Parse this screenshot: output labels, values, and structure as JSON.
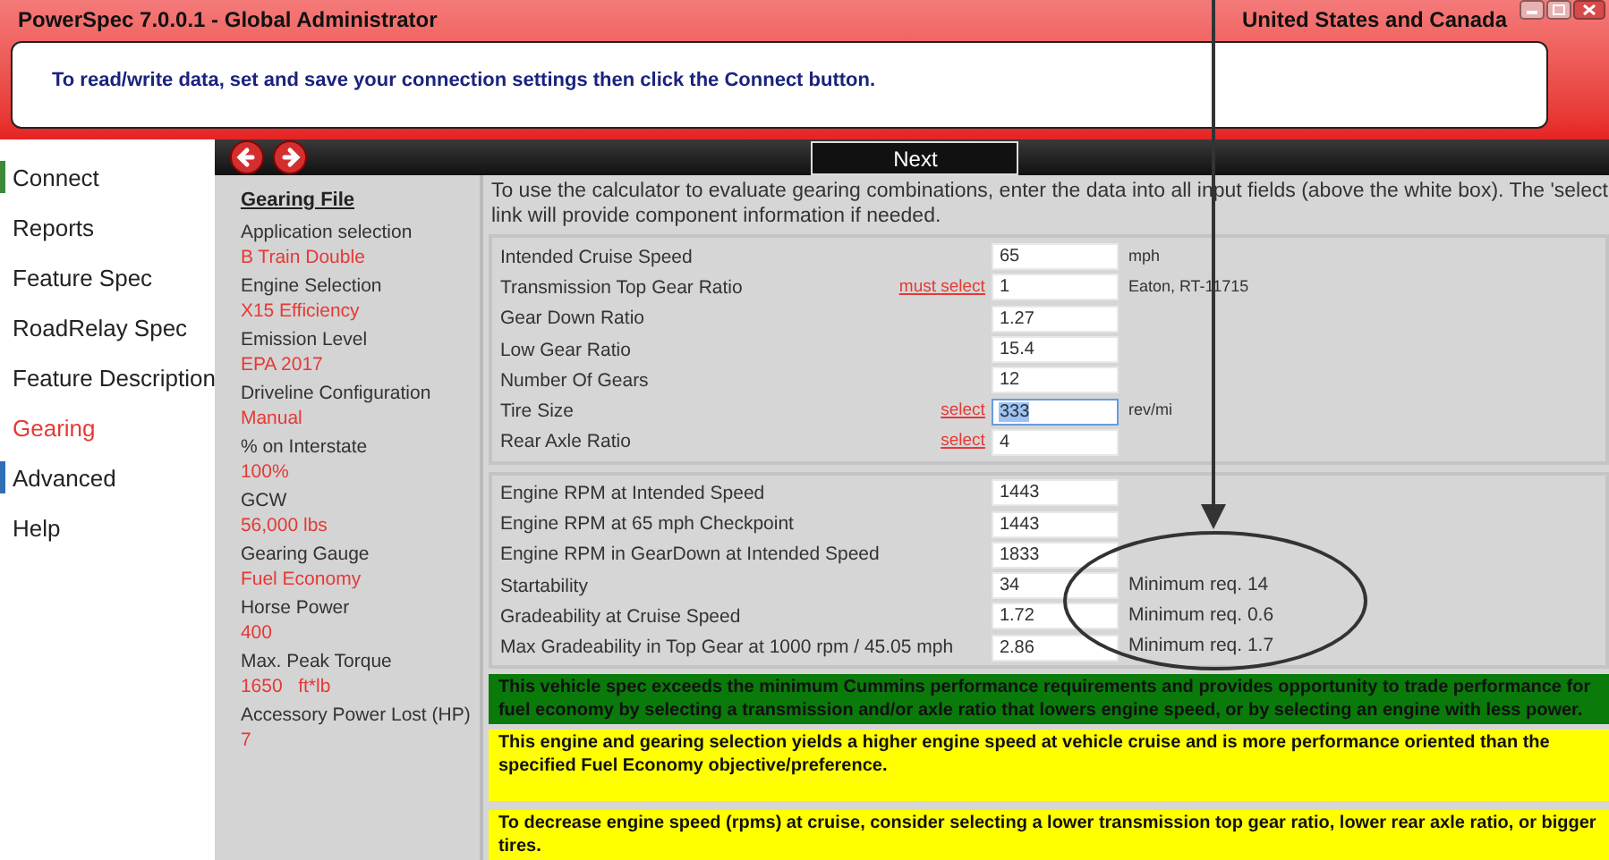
{
  "window": {
    "title": "PowerSpec 7.0.0.1 - Global Administrator",
    "region": "United States and Canada"
  },
  "message": "To read/write data, set and save your connection settings then click the Connect button.",
  "nav": [
    {
      "label": "Connect",
      "selected": false,
      "color": "#3a8a3a"
    },
    {
      "label": "Reports",
      "selected": false
    },
    {
      "label": "Feature Spec",
      "selected": false
    },
    {
      "label": "RoadRelay Spec",
      "selected": false
    },
    {
      "label": "Feature Description",
      "selected": false
    },
    {
      "label": "Gearing",
      "selected": true
    },
    {
      "label": "Advanced",
      "selected": false,
      "color": "#2f6fb5"
    },
    {
      "label": "Help",
      "selected": false
    }
  ],
  "toolbar": {
    "next": "Next"
  },
  "summary": {
    "title": "Gearing File",
    "items": [
      {
        "label": "Application selection",
        "value": "B Train Double"
      },
      {
        "label": "Engine Selection",
        "value": "X15 Efficiency"
      },
      {
        "label": "Emission Level",
        "value": "EPA 2017"
      },
      {
        "label": "Driveline Configuration",
        "value": "Manual"
      },
      {
        "label": "% on Interstate",
        "value": "100%"
      },
      {
        "label": "GCW",
        "value": "56,000 lbs"
      },
      {
        "label": "Gearing Gauge",
        "value": "Fuel Economy"
      },
      {
        "label": "Horse Power",
        "value": "400"
      },
      {
        "label": "Max. Peak Torque",
        "value": "1650   ft*lb"
      },
      {
        "label": "Accessory Power Lost (HP)",
        "value": "7"
      }
    ]
  },
  "instructions": [
    "To use the calculator to evaluate gearing combinations, enter the data into all input fields (above the white box). The 'select",
    "link will provide component information if needed."
  ],
  "inputs": [
    {
      "label": "Intended Cruise Speed",
      "value": "65",
      "unit": "mph"
    },
    {
      "label": "Transmission Top Gear Ratio",
      "link": "must select",
      "value": "1",
      "unit": "Eaton, RT-11715"
    },
    {
      "label": "Gear Down Ratio",
      "value": "1.27"
    },
    {
      "label": "Low Gear Ratio",
      "value": "15.4"
    },
    {
      "label": "Number Of Gears",
      "value": "12"
    },
    {
      "label": "Tire Size",
      "link": "select",
      "value": "333",
      "unit": "rev/mi",
      "selected": true
    },
    {
      "label": "Rear Axle Ratio",
      "link": "select",
      "value": "4"
    }
  ],
  "results": [
    {
      "label": "Engine RPM at Intended Speed",
      "value": "1443"
    },
    {
      "label": "Engine RPM at 65 mph Checkpoint",
      "value": "1443"
    },
    {
      "label": "Engine RPM in GearDown at Intended Speed",
      "value": "1833"
    },
    {
      "label": "Startability",
      "value": "34",
      "note": "Minimum req. 14"
    },
    {
      "label": "Gradeability at Cruise Speed",
      "value": "1.72",
      "note": "Minimum req. 0.6"
    },
    {
      "label": "Max Gradeability in Top Gear at 1000 rpm / 45.05 mph",
      "value": "2.86",
      "note": "Minimum req. 1.7"
    }
  ],
  "messages": [
    {
      "kind": "pass",
      "text": "This vehicle spec exceeds the minimum Cummins performance requirements and provides opportunity to trade performance for fuel economy by selecting a transmission and/or axle ratio that lowers engine speed, or by selecting an engine with less power."
    },
    {
      "kind": "warning",
      "text": "This engine and gearing selection yields a higher engine speed at vehicle cruise and is more performance oriented than the specified Fuel Economy objective/preference."
    },
    {
      "kind": "warning",
      "text": "To decrease engine speed (rpms) at cruise, consider selecting a lower transmission top gear ratio, lower rear axle ratio, or bigger tires."
    }
  ]
}
